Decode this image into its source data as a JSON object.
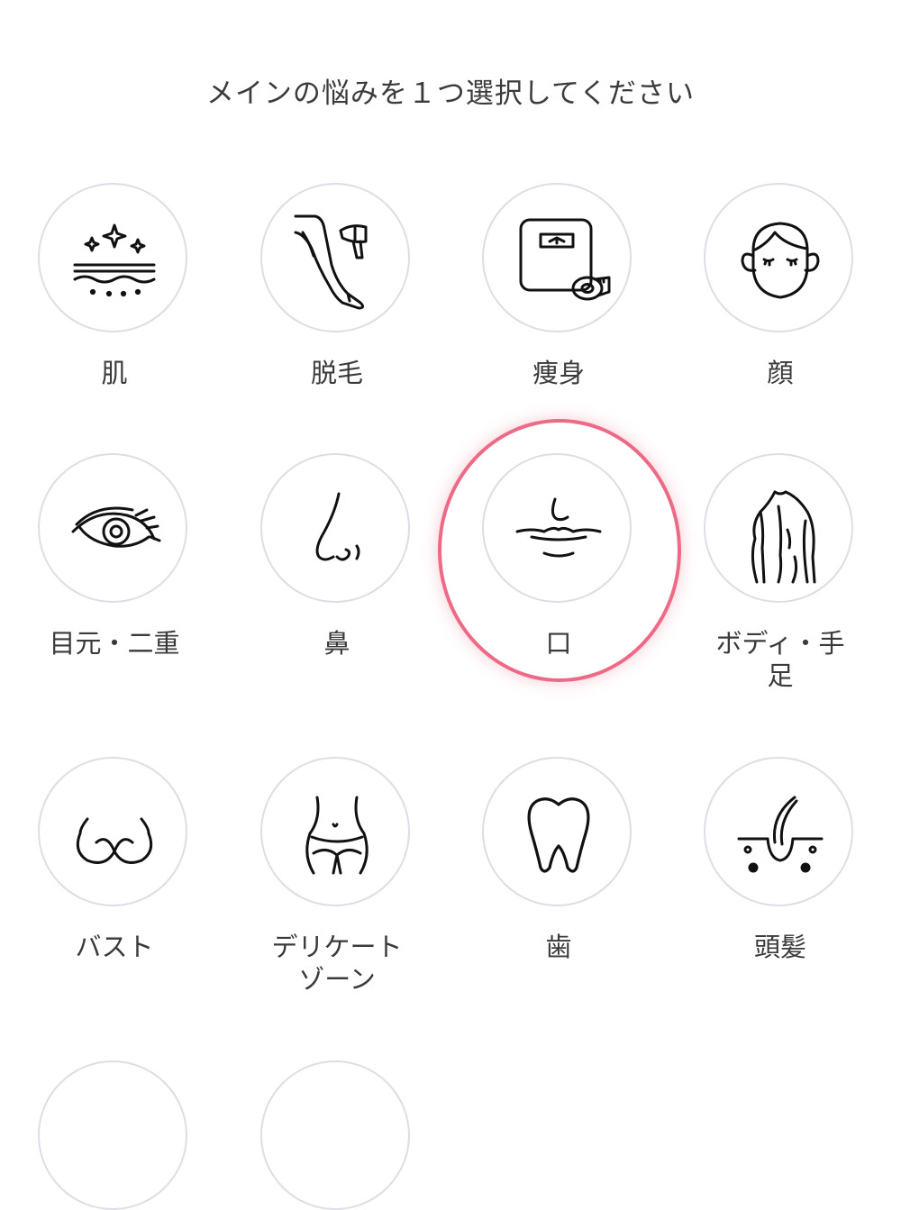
{
  "header": {
    "title": "メインの悩みを１つ選択してください"
  },
  "selection": {
    "selected_item": "口",
    "highlight_color": "#ec6a86"
  },
  "items": [
    {
      "label": "肌",
      "icon": "sparkle-skin-icon"
    },
    {
      "label": "脱毛",
      "icon": "leg-hair-removal-icon"
    },
    {
      "label": "痩身",
      "icon": "scale-tape-measure-icon"
    },
    {
      "label": "顔",
      "icon": "face-icon"
    },
    {
      "label": "目元・二重",
      "icon": "eye-icon"
    },
    {
      "label": "鼻",
      "icon": "nose-icon"
    },
    {
      "label": "口",
      "icon": "mouth-icon"
    },
    {
      "label": "ボディ・手\n足",
      "label_line1": "ボディ・手",
      "label_line2": "足",
      "icon": "body-back-icon"
    },
    {
      "label": "バスト",
      "icon": "bust-icon"
    },
    {
      "label": "デリケート\nゾーン",
      "label_line1": "デリケート",
      "label_line2": "ゾーン",
      "icon": "waist-icon"
    },
    {
      "label": "歯",
      "icon": "tooth-icon"
    },
    {
      "label": "頭髪",
      "icon": "hair-follicle-icon"
    }
  ]
}
